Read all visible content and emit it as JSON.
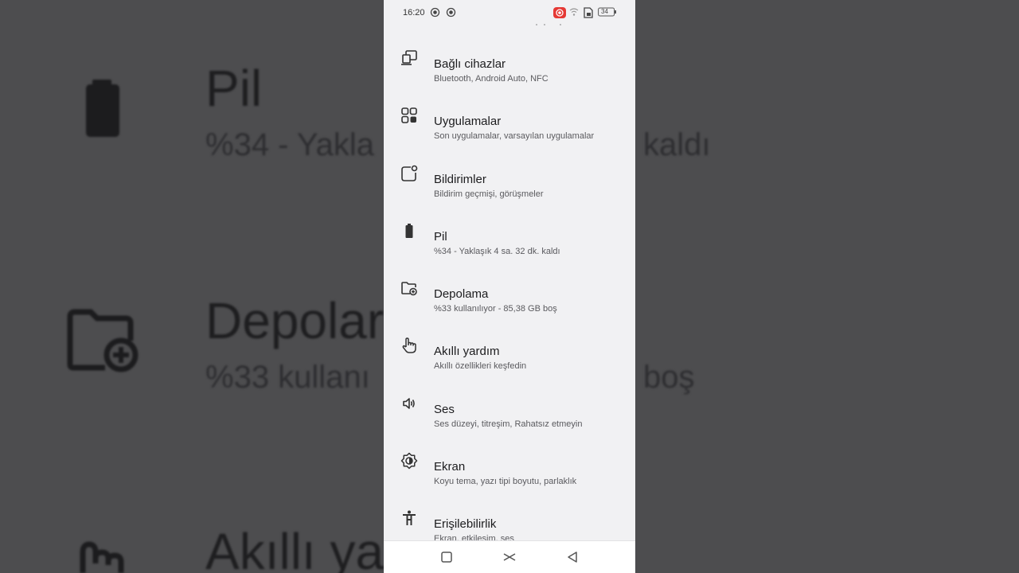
{
  "status_bar": {
    "time": "16:20",
    "battery_level": "34",
    "icons": [
      "screen-record-icon",
      "screen-record-icon",
      "recording-icon",
      "wifi-icon",
      "sim-icon",
      "battery-icon"
    ]
  },
  "background": {
    "items": [
      {
        "title": "Pil",
        "subtitle_left": "%34 - Yakla",
        "subtitle_right": "kaldı"
      },
      {
        "title": "Depolar",
        "subtitle_left": "%33 kullanı",
        "subtitle_right": "boş"
      },
      {
        "title": "Akıllı ya"
      }
    ]
  },
  "settings": {
    "items": [
      {
        "title": "Bağlı cihazlar",
        "subtitle": "Bluetooth, Android Auto, NFC",
        "icon": "connected-devices-icon"
      },
      {
        "title": "Uygulamalar",
        "subtitle": "Son uygulamalar, varsayılan uygulamalar",
        "icon": "apps-icon"
      },
      {
        "title": "Bildirimler",
        "subtitle": "Bildirim geçmişi, görüşmeler",
        "icon": "notifications-icon"
      },
      {
        "title": "Pil",
        "subtitle": "%34 - Yaklaşık 4 sa. 32 dk. kaldı",
        "icon": "battery-icon"
      },
      {
        "title": "Depolama",
        "subtitle": "%33 kullanılıyor - 85,38 GB boş",
        "icon": "storage-folder-icon"
      },
      {
        "title": "Akıllı yardım",
        "subtitle": "Akıllı özellikleri keşfedin",
        "icon": "hand-gesture-icon"
      },
      {
        "title": "Ses",
        "subtitle": "Ses düzeyi, titreşim, Rahatsız etmeyin",
        "icon": "volume-icon"
      },
      {
        "title": "Ekran",
        "subtitle": "Koyu tema, yazı tipi boyutu, parlaklık",
        "icon": "brightness-icon"
      },
      {
        "title": "Erişilebilirlik",
        "subtitle": "Ekran, etkileşim, ses",
        "icon": "accessibility-icon"
      }
    ]
  },
  "nav_bar": {
    "buttons": [
      "recents-square-icon",
      "home-chevron-icon",
      "back-triangle-icon"
    ]
  },
  "colors": {
    "screen_bg": "#f1f1f3",
    "outer_bg": "#4d4d4f",
    "record_red": "#e53935"
  }
}
